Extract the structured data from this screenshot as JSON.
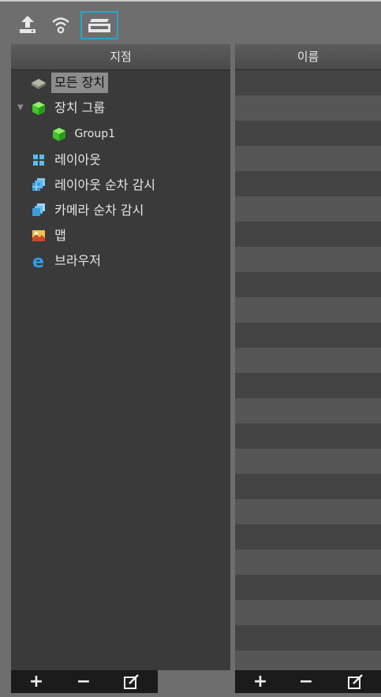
{
  "toolbar": {
    "buttons": [
      {
        "icon": "upload-icon"
      },
      {
        "icon": "wifi-icon"
      },
      {
        "icon": "tray-icon",
        "selected": true
      }
    ]
  },
  "left_panel": {
    "header": "지점",
    "tree": [
      {
        "label": "모든 장치",
        "icon": "all-devices-icon",
        "selected": true
      },
      {
        "label": "장치 그룹",
        "icon": "device-group-icon",
        "expanded": true
      },
      {
        "label": "Group1",
        "icon": "group-icon"
      },
      {
        "label": "레이아웃",
        "icon": "layout-icon"
      },
      {
        "label": "레이아웃 순차 감시",
        "icon": "layout-sequence-icon"
      },
      {
        "label": "카메라 순차 감시",
        "icon": "camera-sequence-icon"
      },
      {
        "label": "맵",
        "icon": "map-icon"
      },
      {
        "label": "브라우저",
        "icon": "browser-icon"
      }
    ]
  },
  "right_panel": {
    "header": "이름"
  },
  "bottom_bar": {
    "left": {
      "add": "+",
      "remove": "−",
      "edit": "edit-icon"
    },
    "right": {
      "add": "+",
      "remove": "−",
      "edit": "edit-icon"
    }
  },
  "colors": {
    "selection_outline": "#2aa3c9",
    "panel": "#3a3a3a",
    "row_alt": "#565656"
  }
}
